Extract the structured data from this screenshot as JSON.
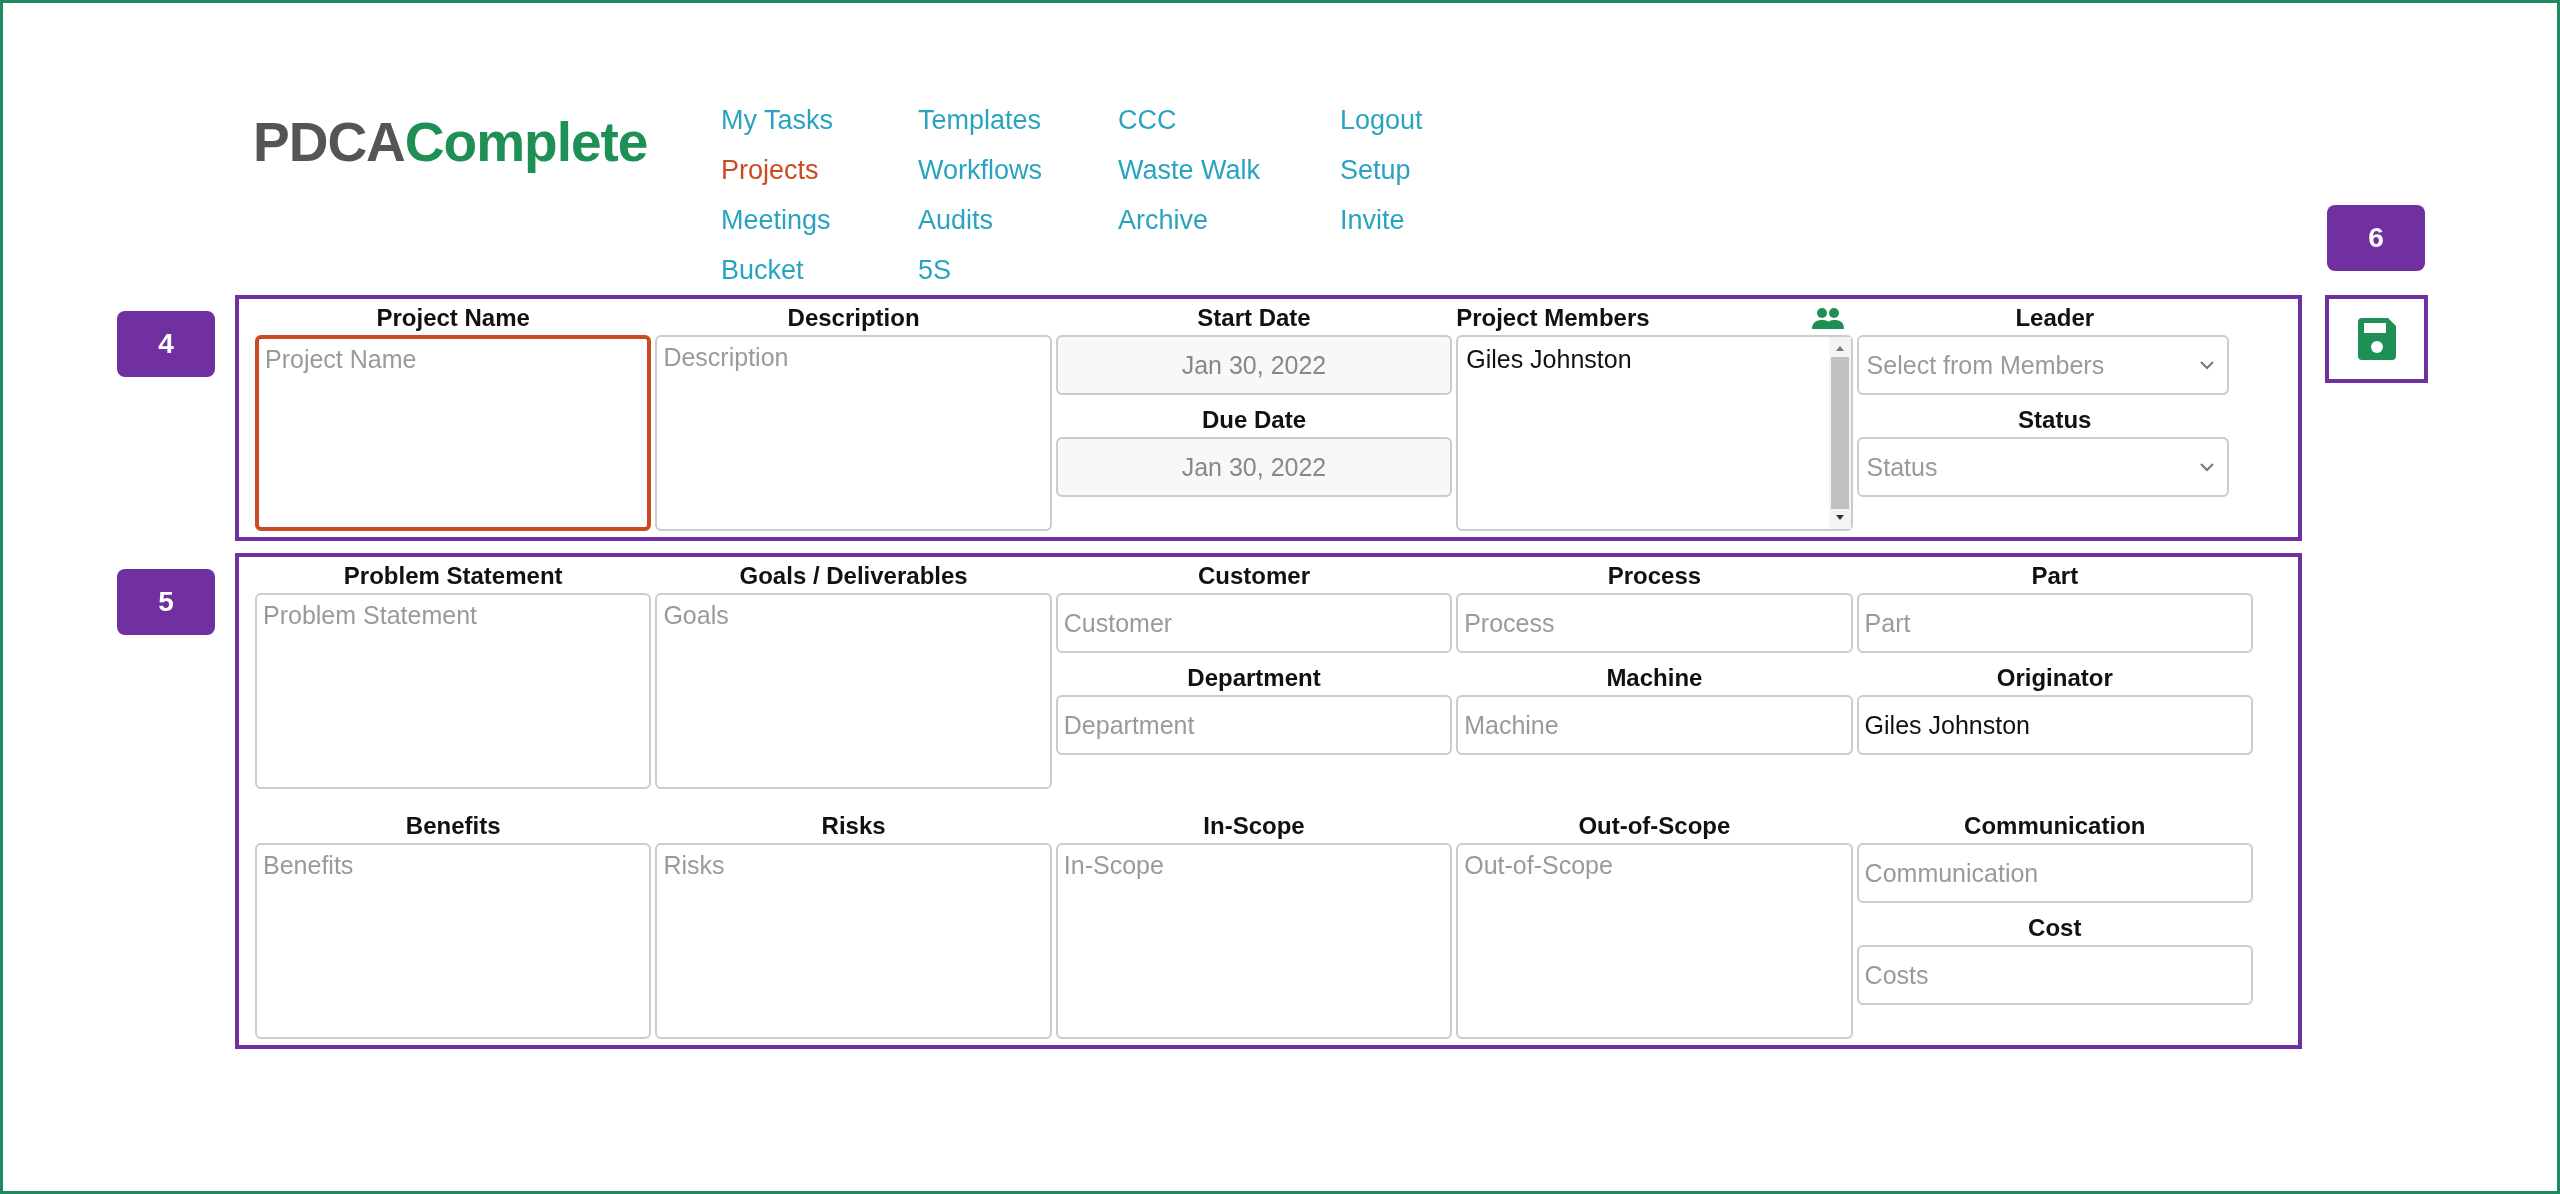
{
  "logo": {
    "part_1": "PDCA",
    "part_2": "Complete"
  },
  "nav": {
    "columns": [
      [
        {
          "label": "My Tasks",
          "selected": false
        },
        {
          "label": "Projects",
          "selected": true
        },
        {
          "label": "Meetings",
          "selected": false
        },
        {
          "label": "Bucket",
          "selected": false
        }
      ],
      [
        {
          "label": "Templates",
          "selected": false
        },
        {
          "label": "Workflows",
          "selected": false
        },
        {
          "label": "Audits",
          "selected": false
        },
        {
          "label": "5S",
          "selected": false
        }
      ],
      [
        {
          "label": "CCC",
          "selected": false
        },
        {
          "label": "Waste Walk",
          "selected": false
        },
        {
          "label": "Archive",
          "selected": false
        }
      ],
      [
        {
          "label": "Logout",
          "selected": false
        },
        {
          "label": "Setup",
          "selected": false
        },
        {
          "label": "Invite",
          "selected": false
        }
      ]
    ]
  },
  "save_callout": "6",
  "sections": [
    {
      "callout": "4",
      "bands": [
        {
          "columns": [
            {
              "fields": [
                {
                  "kind": "textarea",
                  "label": "Project Name",
                  "placeholder": "Project Name",
                  "focused": true
                }
              ]
            },
            {
              "fields": [
                {
                  "kind": "textarea",
                  "label": "Description",
                  "placeholder": "Description",
                  "focused": false
                }
              ]
            },
            {
              "fields": [
                {
                  "kind": "date",
                  "label": "Start Date",
                  "value": "Jan 30, 2022"
                },
                {
                  "kind": "date",
                  "label": "Due Date",
                  "value": "Jan 30, 2022"
                }
              ]
            },
            {
              "fields": [
                {
                  "kind": "members",
                  "label": "Project Members",
                  "items": [
                    "Giles Johnston"
                  ]
                }
              ]
            },
            {
              "fields": [
                {
                  "kind": "select",
                  "label": "Leader",
                  "placeholder": "Select from Members"
                },
                {
                  "kind": "select",
                  "label": "Status",
                  "placeholder": "Status"
                }
              ]
            }
          ]
        }
      ]
    },
    {
      "callout": "5",
      "bands": [
        {
          "columns": [
            {
              "fields": [
                {
                  "kind": "textarea",
                  "label": "Problem Statement",
                  "placeholder": "Problem Statement",
                  "focused": false
                }
              ]
            },
            {
              "fields": [
                {
                  "kind": "textarea",
                  "label": "Goals / Deliverables",
                  "placeholder": "Goals",
                  "focused": false
                }
              ]
            },
            {
              "fields": [
                {
                  "kind": "input",
                  "label": "Customer",
                  "placeholder": "Customer"
                },
                {
                  "kind": "input",
                  "label": "Department",
                  "placeholder": "Department"
                }
              ]
            },
            {
              "fields": [
                {
                  "kind": "input",
                  "label": "Process",
                  "placeholder": "Process"
                },
                {
                  "kind": "input",
                  "label": "Machine",
                  "placeholder": "Machine"
                }
              ]
            },
            {
              "fields": [
                {
                  "kind": "input",
                  "label": "Part",
                  "placeholder": "Part"
                },
                {
                  "kind": "input",
                  "label": "Originator",
                  "value": "Giles Johnston"
                }
              ]
            }
          ]
        },
        {
          "columns": [
            {
              "fields": [
                {
                  "kind": "textarea",
                  "label": "Benefits",
                  "placeholder": "Benefits",
                  "focused": false
                }
              ]
            },
            {
              "fields": [
                {
                  "kind": "textarea",
                  "label": "Risks",
                  "placeholder": "Risks",
                  "focused": false
                }
              ]
            },
            {
              "fields": [
                {
                  "kind": "textarea",
                  "label": "In-Scope",
                  "placeholder": "In-Scope",
                  "focused": false
                }
              ]
            },
            {
              "fields": [
                {
                  "kind": "textarea",
                  "label": "Out-of-Scope",
                  "placeholder": "Out-of-Scope",
                  "focused": false
                }
              ]
            },
            {
              "fields": [
                {
                  "kind": "input",
                  "label": "Communication",
                  "placeholder": "Communication"
                },
                {
                  "kind": "input",
                  "label": "Cost",
                  "placeholder": "Costs"
                }
              ]
            }
          ]
        }
      ]
    }
  ]
}
